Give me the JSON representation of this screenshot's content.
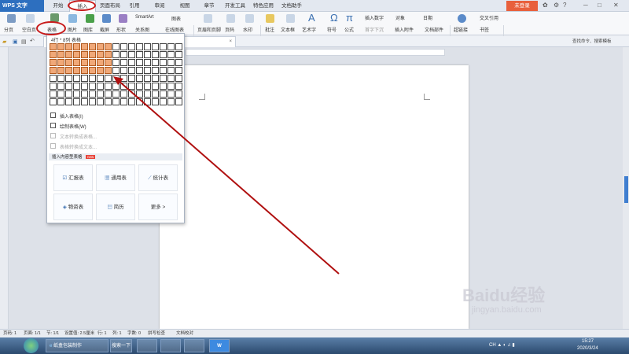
{
  "titlebar": {
    "app": "WPS 文字",
    "menus": [
      "开始",
      "插入",
      "页面布局",
      "引用",
      "审阅",
      "视图",
      "章节",
      "开发工具",
      "特色应用",
      "文档助手"
    ],
    "login": "未登录"
  },
  "ribbon": {
    "items": [
      "分页",
      "空白页",
      "表格",
      "图片",
      "图库",
      "截屏",
      "形状",
      "SmartArt",
      "图表",
      "关系图",
      "在线图表",
      "页眉和页脚",
      "页码",
      "水印",
      "批注",
      "文本框",
      "艺术字",
      "符号",
      "公式",
      "插入数字",
      "对象",
      "日期",
      "首字下沉",
      "插入附件",
      "文档部件",
      "超链接",
      "交叉引用",
      "书签"
    ]
  },
  "search": {
    "placeholder": "查找命令、搜索模板"
  },
  "table_dropdown": {
    "size_label": "4行 * 8列 表格",
    "items": [
      "插入表格(I)",
      "绘制表格(W)",
      "文本转换成表格...",
      "表格转换成文本..."
    ],
    "section_title": "插入内容型表格",
    "new_badge": "new",
    "templates": [
      "汇报表",
      "通用表",
      "统计表",
      "物资表",
      "简历",
      "更多 >"
    ]
  },
  "statusbar": {
    "items": [
      "页码: 1",
      "页面: 1/1",
      "节: 1/1",
      "设置值: 2.5厘米",
      "行: 1",
      "列: 1",
      "字数: 0",
      "拼写检查",
      "文档校对"
    ]
  },
  "taskbar": {
    "items": [
      "纸盒包装制作",
      "搜索一下"
    ],
    "time": "15:27",
    "date": "2020/3/24"
  },
  "watermark": {
    "text": "Baidu经验",
    "sub": "jingyan.baidu.com"
  },
  "colors": {
    "accent": "#2d6fbf",
    "highlight": "#f0a878",
    "annotation": "#c81a1a"
  }
}
